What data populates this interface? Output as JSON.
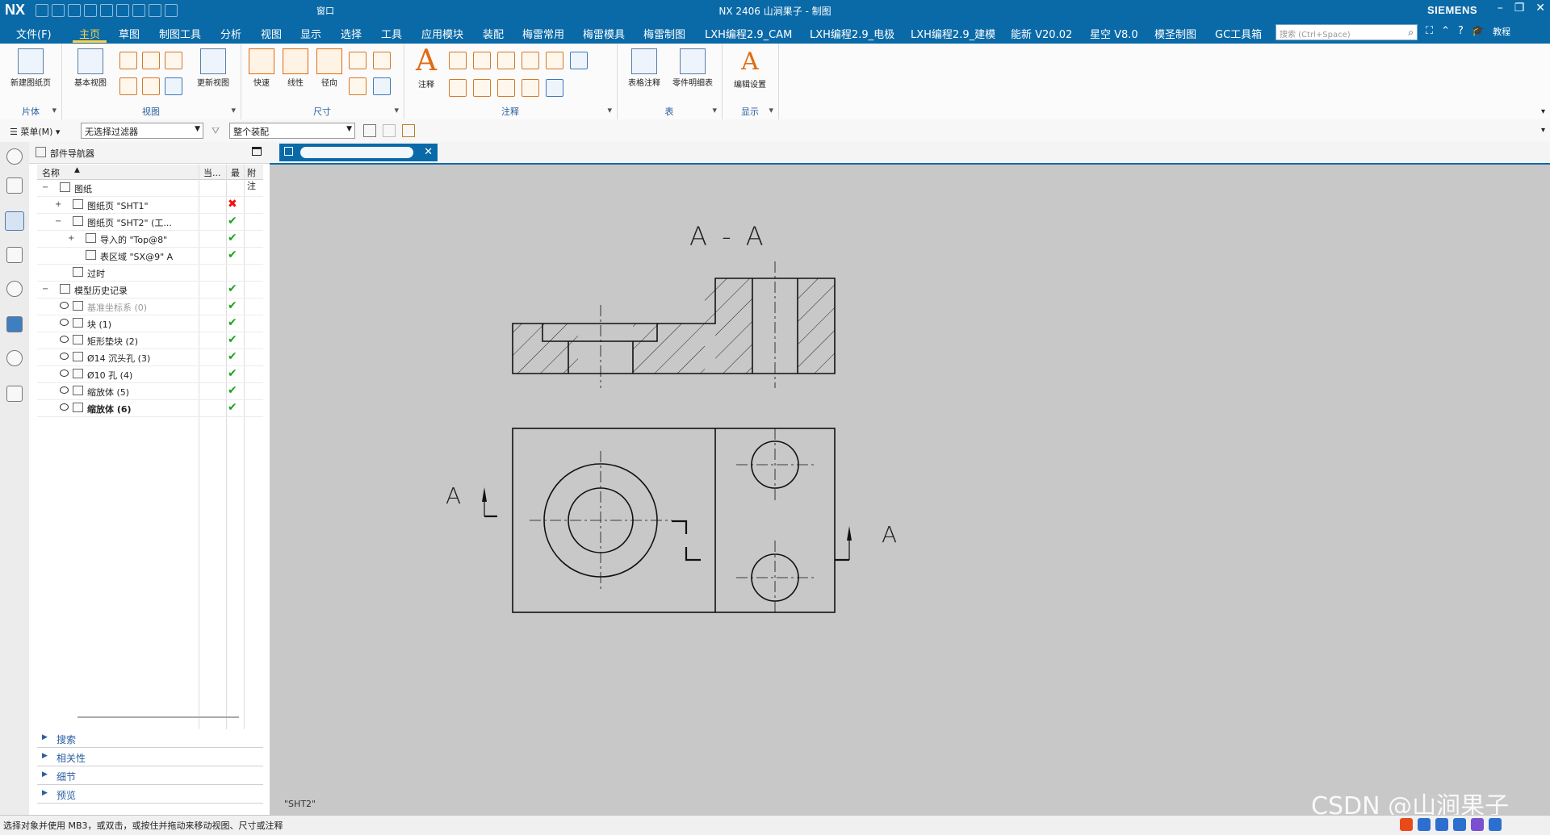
{
  "window": {
    "logo": "NX",
    "title": "NX 2406 山涧果子 - 制图",
    "brand": "SIEMENS",
    "window_menu": "窗口",
    "quick_access_icons": [
      "save-icon",
      "undo-icon",
      "redo-icon",
      "copy-icon",
      "paste-icon",
      "delete-icon",
      "mic-icon",
      "touch-mode-icon",
      "window-icon"
    ]
  },
  "menubar": {
    "items": [
      "文件(F)",
      "主页",
      "草图",
      "制图工具",
      "分析",
      "视图",
      "显示",
      "选择",
      "工具",
      "应用模块",
      "装配",
      "梅雷常用",
      "梅雷模具",
      "梅雷制图",
      "LXH编程2.9_CAM",
      "LXH编程2.9_电极",
      "LXH编程2.9_建模",
      "能新 V20.02",
      "星空 V8.0",
      "模圣制图",
      "GC工具箱"
    ],
    "active": "主页",
    "search_placeholder": "搜索 (Ctrl+Space)",
    "help_label": "教程"
  },
  "ribbon": {
    "groups": [
      {
        "name": "片体",
        "buttons": [
          "新建图纸页"
        ]
      },
      {
        "name": "视图",
        "buttons": [
          "基本视图",
          "更新视图"
        ]
      },
      {
        "name": "尺寸",
        "buttons": [
          "快速",
          "线性",
          "径向"
        ]
      },
      {
        "name": "注释",
        "buttons": [
          "注释"
        ]
      },
      {
        "name": "表",
        "buttons": [
          "表格注释",
          "零件明细表"
        ]
      },
      {
        "name": "显示",
        "buttons": [
          "编辑设置"
        ]
      }
    ]
  },
  "filterbar": {
    "menu_label": "菜单(M)",
    "selection_filter": "无选择过滤器",
    "scope": "整个装配"
  },
  "navigator": {
    "title": "部件导航器",
    "columns": [
      "名称",
      "当...",
      "最",
      "附注"
    ],
    "rows": [
      {
        "label": "图纸",
        "indent": 0,
        "status": ""
      },
      {
        "label": "图纸页 \"SHT1\"",
        "indent": 1,
        "status": "bad"
      },
      {
        "label": "图纸页 \"SHT2\" (工...",
        "indent": 1,
        "status": "ok"
      },
      {
        "label": "导入的 \"Top@8\"",
        "indent": 2,
        "status": "ok"
      },
      {
        "label": "表区域 \"SX@9\" A",
        "indent": 2,
        "status": "ok"
      },
      {
        "label": "过时",
        "indent": 1,
        "status": ""
      },
      {
        "label": "模型历史记录",
        "indent": 0,
        "status": "ok"
      },
      {
        "label": "基准坐标系 (0)",
        "indent": 1,
        "status": "ok",
        "dim": true
      },
      {
        "label": "块 (1)",
        "indent": 1,
        "status": "ok"
      },
      {
        "label": "矩形垫块 (2)",
        "indent": 1,
        "status": "ok"
      },
      {
        "label": "Ø14 沉头孔 (3)",
        "indent": 1,
        "status": "ok"
      },
      {
        "label": "Ø10 孔 (4)",
        "indent": 1,
        "status": "ok"
      },
      {
        "label": "缩放体 (5)",
        "indent": 1,
        "status": "ok"
      },
      {
        "label": "缩放体 (6)",
        "indent": 1,
        "status": "ok",
        "bold": true
      }
    ],
    "sections": [
      "搜索",
      "相关性",
      "细节",
      "预览"
    ]
  },
  "drawing": {
    "tab_close": "✕",
    "section_title": "A - A",
    "cut_label_left": "A",
    "cut_label_right": "A",
    "sheet_name": "\"SHT2\""
  },
  "watermark": "CSDN @山涧果子",
  "statusbar": {
    "message": "选择对象并使用 MB3，或双击，或按住并拖动来移动视图、尺寸或注释"
  },
  "colors": {
    "titlebar": "#0a6aa8",
    "active_menu": "#ffd24a",
    "canvas": "#c8c8c8",
    "ok": "#1aa51a",
    "bad": "#ee1111"
  }
}
